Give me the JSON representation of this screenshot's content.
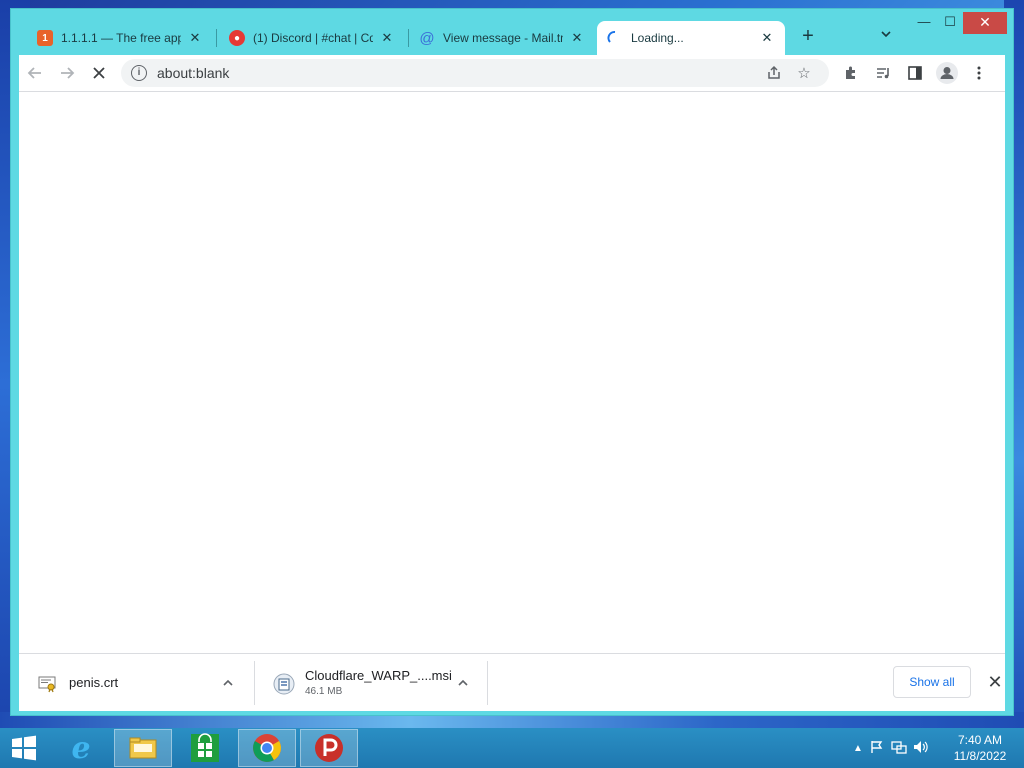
{
  "tabs": [
    {
      "title": "1.1.1.1 — The free app",
      "favicon": "cloudflare-1111-icon",
      "active": false
    },
    {
      "title": "(1) Discord | #chat | Cd",
      "favicon": "discord-icon",
      "active": false
    },
    {
      "title": "View message - Mail.tm",
      "favicon": "at-sign-icon",
      "active": false
    },
    {
      "title": "Loading...",
      "favicon": "loading-spinner-icon",
      "active": true
    }
  ],
  "toolbar": {
    "url": "about:blank"
  },
  "downloads": [
    {
      "name": "penis.crt",
      "size": ""
    },
    {
      "name": "Cloudflare_WARP_....msi",
      "size": "46.1 MB"
    }
  ],
  "download_bar": {
    "show_all_label": "Show all"
  },
  "taskbar": {
    "time": "7:40 AM",
    "date": "11/8/2022"
  },
  "colors": {
    "window_frame": "#5ed9e3",
    "close_button": "#c94a46",
    "link_blue": "#1a73e8",
    "taskbar": "#2a8fc4"
  }
}
